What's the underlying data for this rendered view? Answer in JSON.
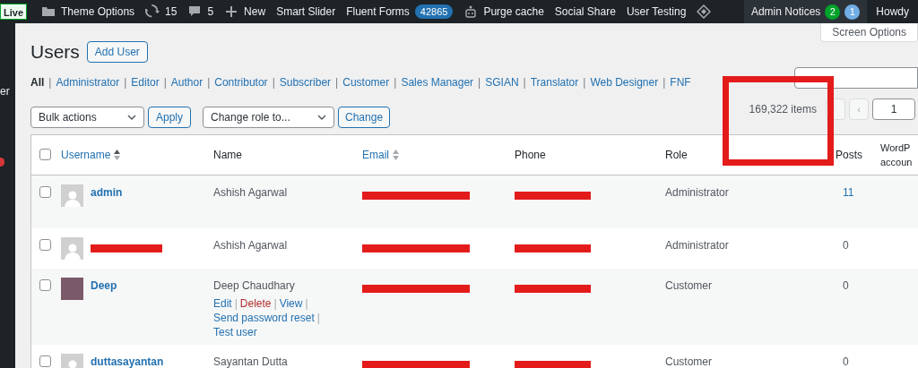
{
  "admin_bar": {
    "live_badge": "Live",
    "items": [
      {
        "kind": "folder",
        "label": "Theme Options"
      },
      {
        "kind": "updates",
        "label": "15"
      },
      {
        "kind": "comments",
        "label": "5"
      },
      {
        "kind": "new",
        "label": "New"
      },
      {
        "kind": "text",
        "label": "Smart Slider"
      },
      {
        "kind": "badge",
        "label": "Fluent Forms",
        "badge": "42865"
      },
      {
        "kind": "robot",
        "label": "Purge cache"
      },
      {
        "kind": "text",
        "label": "Social Share"
      },
      {
        "kind": "text",
        "label": "User Testing"
      },
      {
        "kind": "diamond"
      }
    ],
    "notices": {
      "label": "Admin Notices",
      "counts": [
        {
          "text": "2",
          "color": "#00a32a"
        },
        {
          "text": "1",
          "color": "#72aee6"
        }
      ]
    },
    "howdy": "Howdy"
  },
  "sidebar": {
    "partial_text": "er"
  },
  "screen_options": "Screen Options",
  "page": {
    "title": "Users",
    "add_button": "Add User"
  },
  "filter_separator": "|",
  "filters": [
    {
      "label": "All",
      "selected": true
    },
    {
      "label": "Administrator",
      "selected": false
    },
    {
      "label": "Editor",
      "selected": false
    },
    {
      "label": "Author",
      "selected": false
    },
    {
      "label": "Contributor",
      "selected": false
    },
    {
      "label": "Subscriber",
      "selected": false
    },
    {
      "label": "Customer",
      "selected": false
    },
    {
      "label": "Sales Manager",
      "selected": false
    },
    {
      "label": "SGIAN",
      "selected": false
    },
    {
      "label": "Translator",
      "selected": false
    },
    {
      "label": "Web Designer",
      "selected": false
    },
    {
      "label": "FNF",
      "selected": false
    }
  ],
  "bulk_actions": {
    "value": "Bulk actions",
    "apply": "Apply"
  },
  "change_role": {
    "value": "Change role to...",
    "button": "Change"
  },
  "pagination": {
    "items": "169,322 items",
    "prev": "‹",
    "page": "1"
  },
  "table": {
    "select_all_checked": false,
    "action_separator": "|",
    "columns": [
      {
        "label": "Username",
        "sortable": true
      },
      {
        "label": "Name",
        "sortable": false
      },
      {
        "label": "Email",
        "sortable": true
      },
      {
        "label": "Phone",
        "sortable": false
      },
      {
        "label": "Role",
        "sortable": false
      },
      {
        "label": "Posts",
        "sortable": false
      },
      {
        "lines": [
          "WordP",
          "accoun"
        ],
        "sortable": false
      }
    ],
    "rows": [
      {
        "checked": false,
        "username": "admin",
        "photo": false,
        "name": "Ashish Agarwal",
        "email_redacted": true,
        "phone_redacted": true,
        "role": "Administrator",
        "posts": "11",
        "posts_link": true
      },
      {
        "checked": false,
        "username_redacted": true,
        "photo": false,
        "name": "Ashish Agarwal",
        "email_redacted": true,
        "phone_redacted": true,
        "role": "Administrator",
        "posts": "0",
        "posts_link": false
      },
      {
        "checked": false,
        "username": "Deep",
        "photo": true,
        "name": "Deep Chaudhary",
        "actions": [
          {
            "label": "Edit",
            "kind": "link"
          },
          {
            "label": "Delete",
            "kind": "danger"
          },
          {
            "label": "View",
            "kind": "link"
          },
          {
            "label": "Send password reset",
            "kind": "link"
          },
          {
            "label": "Test user",
            "kind": "link"
          }
        ],
        "email_redacted": true,
        "phone_redacted": true,
        "role": "Customer",
        "posts": "0",
        "posts_link": false
      },
      {
        "checked": false,
        "username": "duttasayantan",
        "photo": false,
        "name": "Sayantan Dutta",
        "email_redacted": true,
        "phone_redacted": true,
        "role": "Customer",
        "posts": "0",
        "posts_link": false
      }
    ]
  },
  "annotation": {
    "kind": "rectangle"
  }
}
